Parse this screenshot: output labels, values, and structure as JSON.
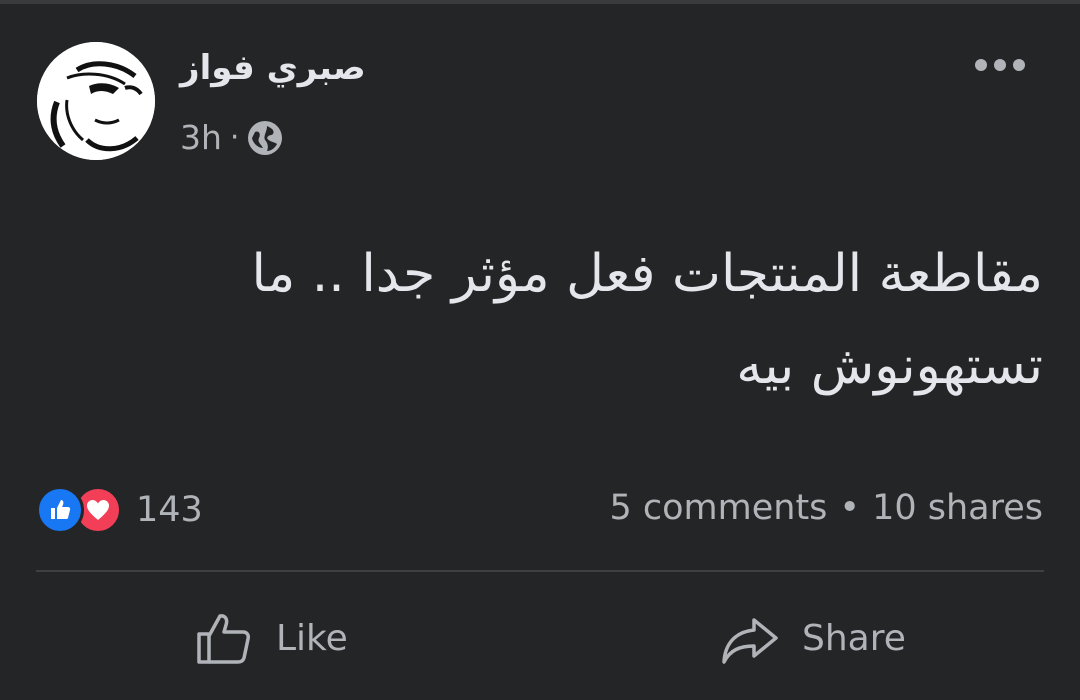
{
  "post": {
    "author_name": "صبري فواز",
    "time": "3h",
    "separator": "·",
    "privacy_icon": "globe-icon",
    "menu_icon": "more-options-icon",
    "text_line1": "مقاطعة المنتجات فعل مؤثر جدا .. ما",
    "text_line2": "تستهونوش بيه"
  },
  "engagement": {
    "reaction_icons": [
      "like-reaction-icon",
      "love-reaction-icon"
    ],
    "reaction_count": "143",
    "comments": "5 comments",
    "dot": "•",
    "shares": "10 shares"
  },
  "actions": {
    "like_label": "Like",
    "share_label": "Share"
  },
  "colors": {
    "background": "#242526",
    "text_primary": "#e4e6eb",
    "text_secondary": "#b0b3b8",
    "like_blue": "#1877f2",
    "love_red": "#f33e58",
    "divider": "#3e4042"
  }
}
